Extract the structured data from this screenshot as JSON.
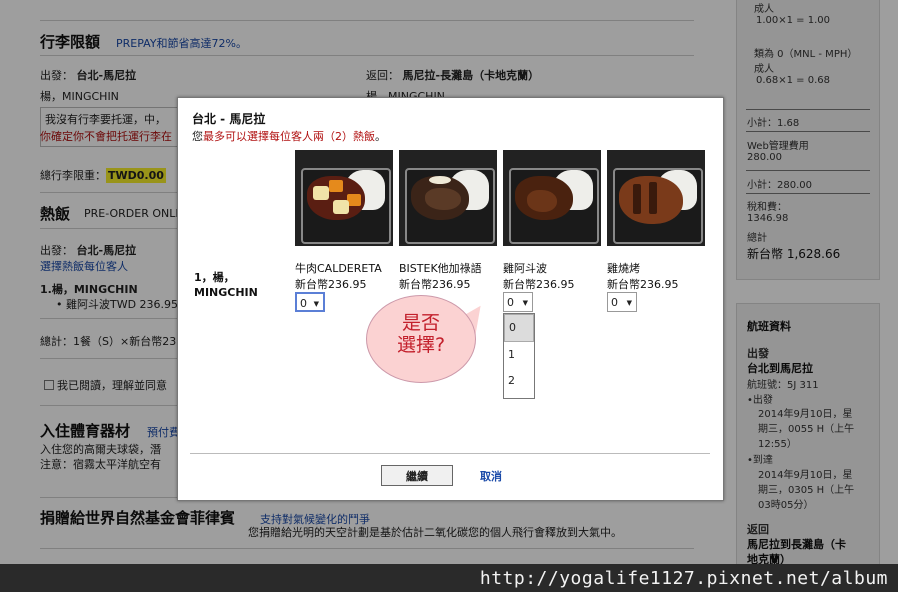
{
  "background": {
    "baggage": {
      "title": "行李限額",
      "promo": "PREPAY和節省高達72%。",
      "depart_label": "出發：",
      "depart_route": "台北-馬尼拉",
      "return_label": "返回：",
      "return_route": "馬尼拉-長灘島（卡地克蘭）",
      "passenger": "楊，MINGCHIN",
      "passenger_return": "楊，MINGCHIN",
      "notice_line1": "我沒有行李要托運，中，",
      "notice_line2": "你確定你不會把托運行李在",
      "total_label": "總行李限重：",
      "total_value": "TWD0.00"
    },
    "meals": {
      "title": "熱飯",
      "subtitle": "PRE-ORDER ONLIN",
      "depart_label": "出發：",
      "depart_route": "台北-馬尼拉",
      "select_link": "選擇熱飯每位客人",
      "pax_line": "1.楊，MINGCHIN",
      "item": "雞阿斗波TWD 236.95",
      "total": "總計：1餐（S）×新台幣23"
    },
    "agree": "我已閱讀，理解並同意",
    "sports": {
      "title": "入住體育器材",
      "sub": "預付費",
      "line1": "入住您的高爾夫球袋，潛",
      "line2": "注意：宿霧太平洋航空有"
    },
    "donate": {
      "title": "捐贈給世界自然基金會菲律賓",
      "sub": "支持對氣候變化的鬥爭",
      "line": "您捐贈給光明的天空計劃是基於估計二氧化碳您的個人飛行會釋放到大氣中。"
    }
  },
  "sidebar": {
    "adult1_label": "成人",
    "adult1_calc": "1.00×1 = 1.00",
    "fee_label": "類為 0（MNL - MPH）",
    "adult2_label": "成人",
    "adult2_calc": "0.68×1 = 0.68",
    "subtotal1": "小計：1.68",
    "web_fee_label": "Web管理費用",
    "web_fee_value": "280.00",
    "subtotal2": "小計：280.00",
    "tax_label": "稅和費：",
    "tax_value": "1346.98",
    "total_label": "總計",
    "total_value": "新台幣 1,628.66",
    "flight_title": "航班資料",
    "depart_head": "出發",
    "depart_route": "台北到馬尼拉",
    "flight_no": "航班號：5J 311",
    "dep_label": "•出發",
    "dep_time1": "2014年9月10日，星",
    "dep_time2": "期三，0055 H（上午",
    "dep_time3": "12:55）",
    "arr_label": "•到達",
    "arr_time1": "2014年9月10日，星",
    "arr_time2": "期三，0305 H（上午",
    "arr_time3": "03時05分）",
    "return_head": "返回",
    "return_route1": "馬尼拉到長灘島（卡",
    "return_route2": "地克蘭）"
  },
  "modal": {
    "title": "台北 - 馬尼拉",
    "subtitle_pre": "您",
    "subtitle_red": "最多可以選擇每位客人兩（2）熱飯",
    "subtitle_post": "。",
    "passenger_line1": "1，楊，",
    "passenger_line2": "MINGCHIN",
    "meals": [
      {
        "name": "牛肉CALDERETA",
        "price": "新台幣236.95",
        "qty": "0"
      },
      {
        "name": "BISTEK他加祿語",
        "price": "新台幣236.95",
        "qty": ""
      },
      {
        "name": "雞阿斗波",
        "price": "新台幣236.95",
        "qty": "0"
      },
      {
        "name": "雞燒烤",
        "price": "新台幣236.95",
        "qty": "0"
      }
    ],
    "dropdown_options": [
      "0",
      "1",
      "2"
    ],
    "continue_label": "繼續",
    "cancel_label": "取消"
  },
  "annotation": {
    "line1": "是否",
    "line2": "選擇?"
  },
  "watermark": "http://yogalife1127.pixnet.net/album",
  "colors": {
    "link_blue": "#1a4aa8",
    "alert_red": "#b01010",
    "highlight_yellow": "#f7ef2a",
    "bubble_pink": "#fbd2d2"
  }
}
